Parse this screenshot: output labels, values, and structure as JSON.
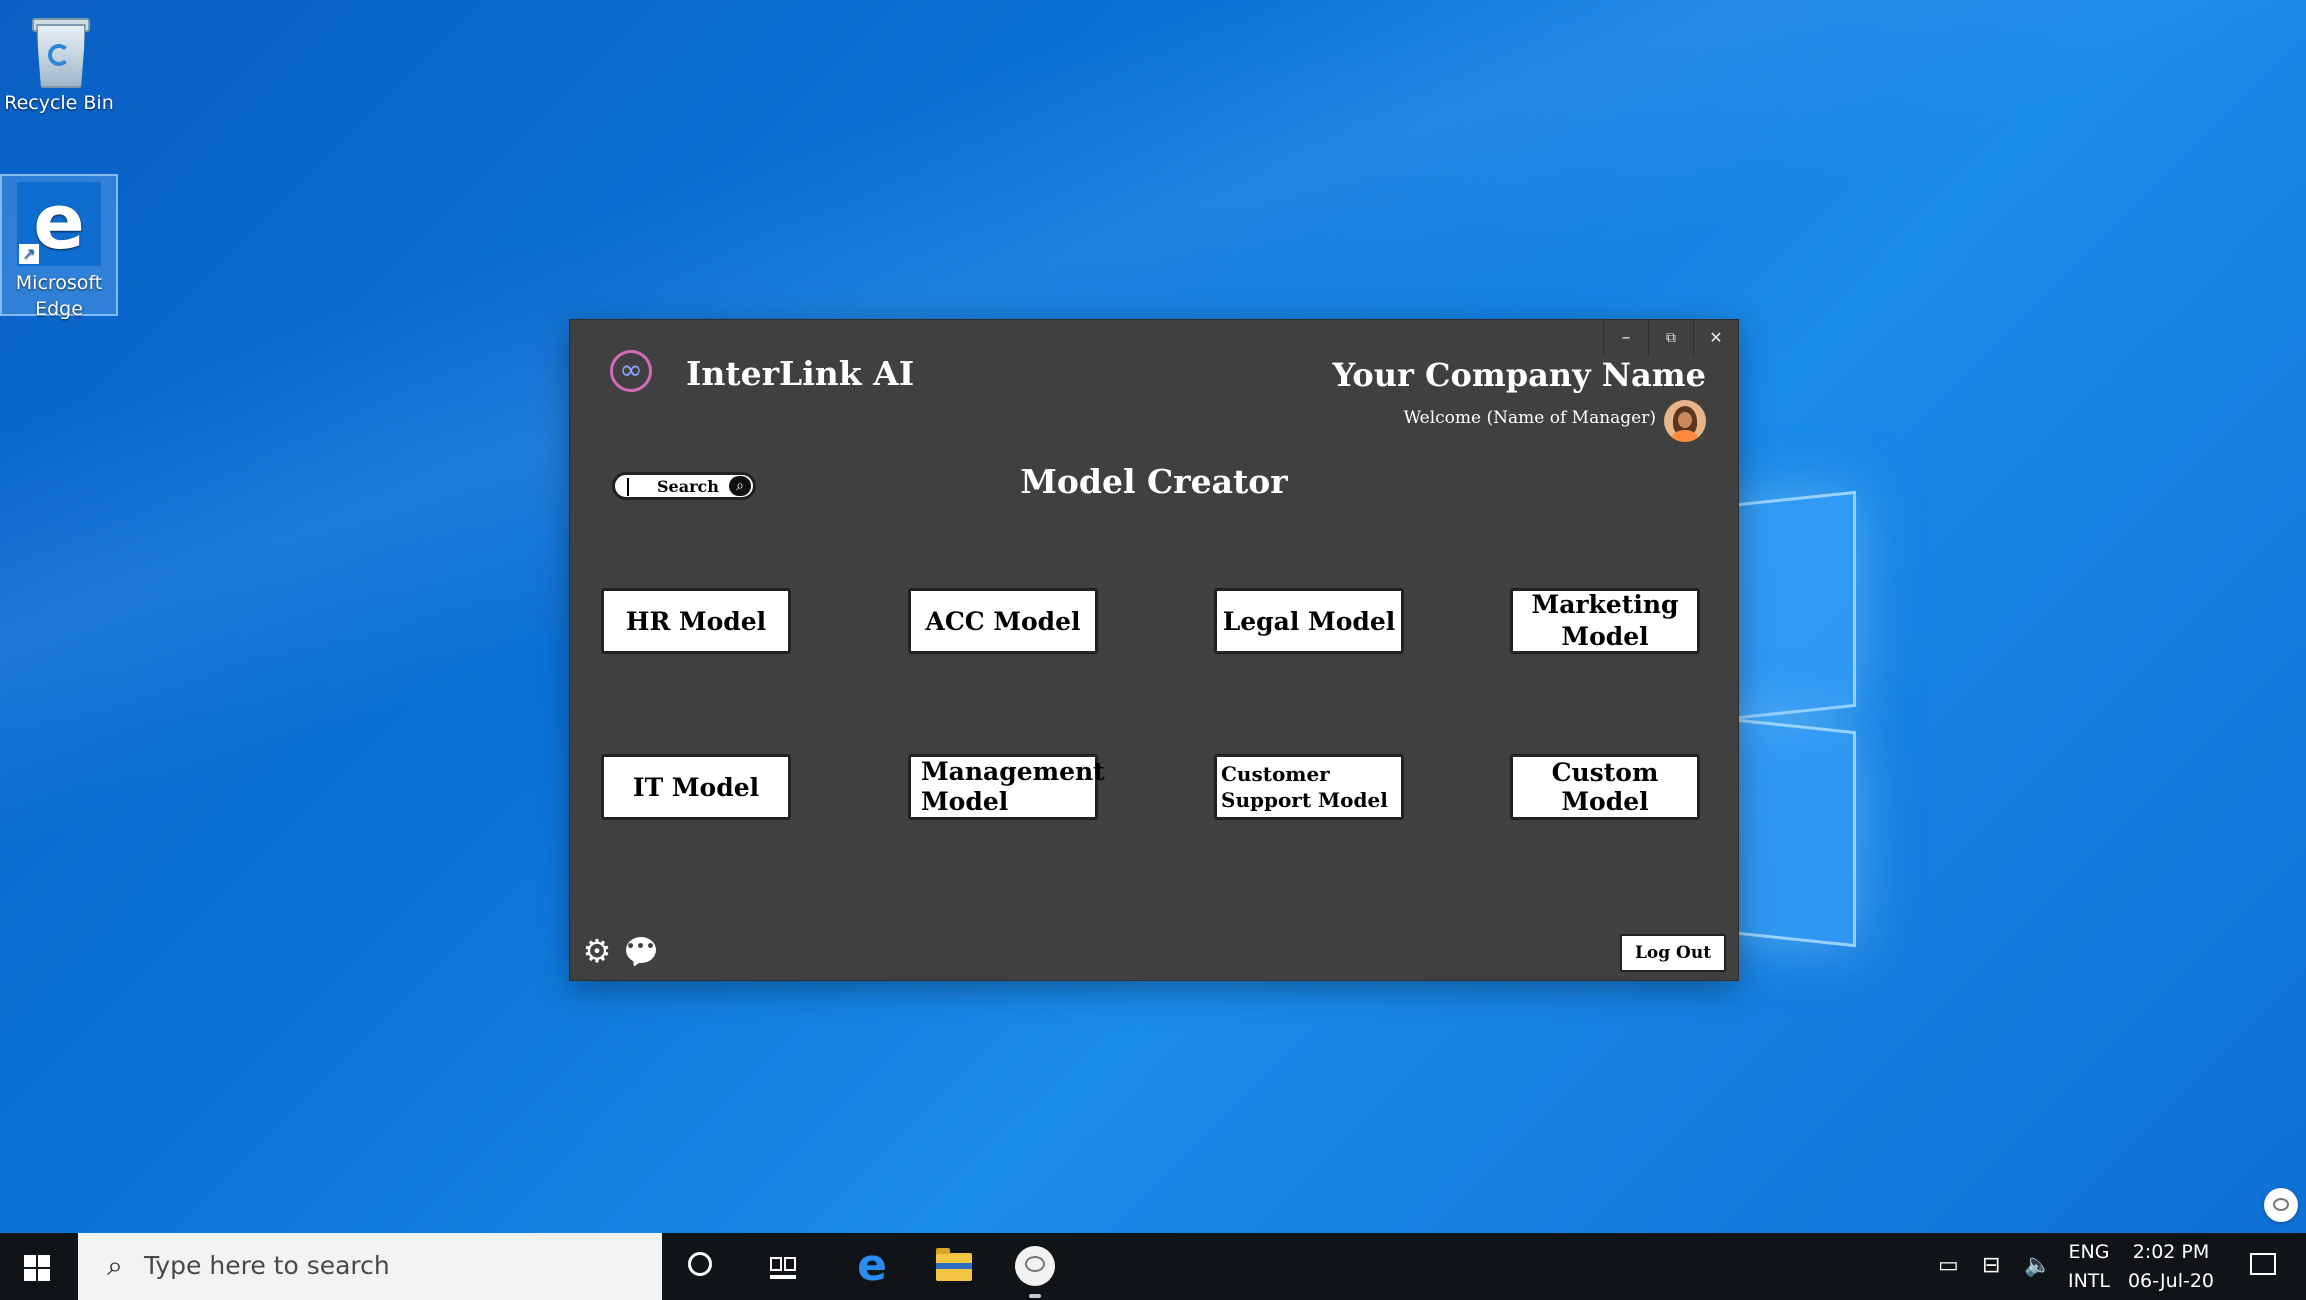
{
  "desktop": {
    "icons": [
      {
        "label": "Recycle Bin",
        "icon": "recycle-bin-icon"
      },
      {
        "label": "Microsoft Edge",
        "icon": "edge-icon"
      }
    ]
  },
  "app": {
    "window_controls": {
      "minimize": "–",
      "restore": "⧉",
      "close": "✕"
    },
    "brand": "InterLink AI",
    "logo_icon": "infinity-logo-icon",
    "company": "Your Company Name",
    "welcome": "Welcome (Name of Manager)",
    "search": {
      "placeholder": "Search",
      "icon": "search-icon"
    },
    "section_title": "Model Creator",
    "models": [
      {
        "label": "HR Model"
      },
      {
        "label": "ACC Model"
      },
      {
        "label": "Legal Model"
      },
      {
        "label": "Marketing Model"
      },
      {
        "label": "IT Model"
      },
      {
        "label": "Management Model"
      },
      {
        "label": "Customer Support Model"
      },
      {
        "label": "Custom Model"
      }
    ],
    "footer": {
      "settings_icon": "gear-icon",
      "chat_icon": "chat-icon",
      "logout": "Log Out"
    }
  },
  "taskbar": {
    "search_placeholder": "Type here to search",
    "pinned": [
      "cortana-icon",
      "task-view-icon",
      "edge-icon",
      "file-explorer-icon",
      "chat-app-icon"
    ],
    "tray": {
      "lang_line1": "ENG",
      "lang_line2": "INTL",
      "time": "2:02 PM",
      "date": "06-Jul-20"
    }
  },
  "colors": {
    "window_bg": "#404040",
    "desktop_blue": "#0b73d6",
    "taskbar_bg": "#101417",
    "button_bg": "#ffffff"
  }
}
